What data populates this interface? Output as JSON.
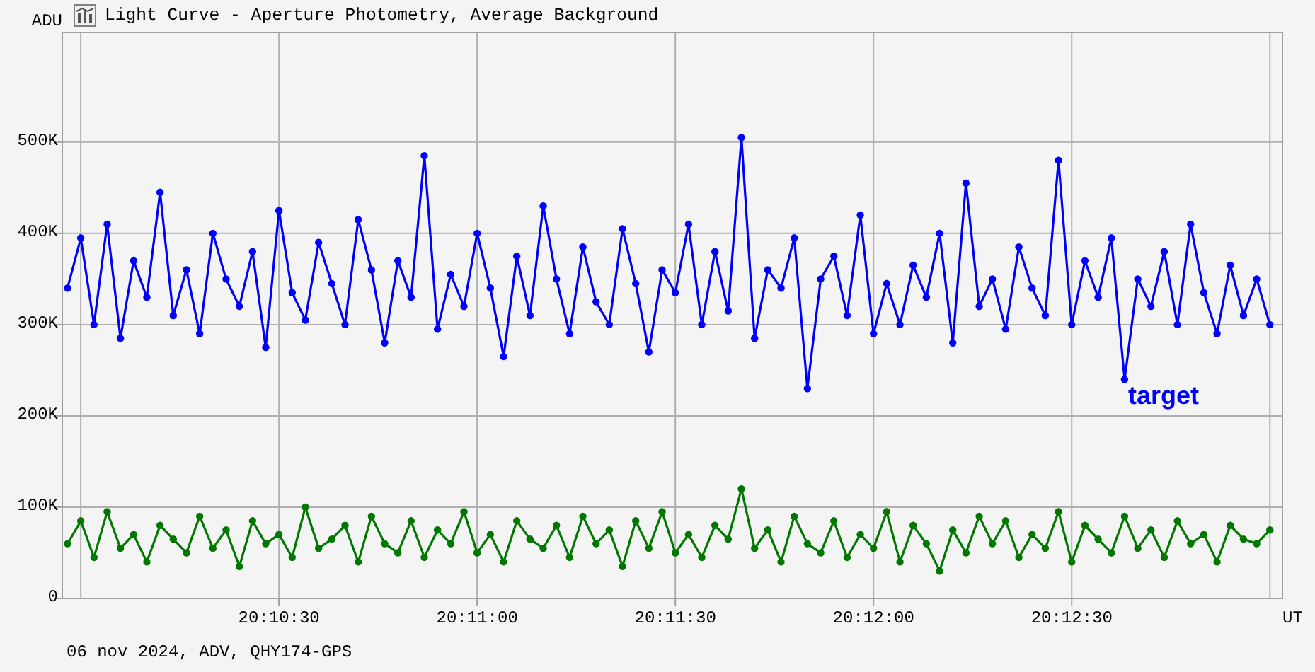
{
  "window": {
    "title": "Light Curve - Aperture Photometry, Average Background"
  },
  "chart": {
    "chart_data": {
      "type": "line",
      "grid": true,
      "ylabel": "ADU",
      "xlabel": "UT",
      "xlim": [
        72597.2,
        72781.9
      ],
      "ylim": [
        0,
        620000
      ],
      "xticks": [
        {
          "value": 72630,
          "label": "20:10:30"
        },
        {
          "value": 72660,
          "label": "20:11:00"
        },
        {
          "value": 72690,
          "label": "20:11:30"
        },
        {
          "value": 72720,
          "label": "20:12:00"
        },
        {
          "value": 72750,
          "label": "20:12:30"
        }
      ],
      "yticks": [
        {
          "value": 0,
          "label": "0"
        },
        {
          "value": 100000,
          "label": "100K"
        },
        {
          "value": 200000,
          "label": "200K"
        },
        {
          "value": 300000,
          "label": "300K"
        },
        {
          "value": 400000,
          "label": "400K"
        },
        {
          "value": 500000,
          "label": "500K"
        }
      ],
      "x": [
        72598,
        72600,
        72602,
        72604,
        72606,
        72608,
        72610,
        72612,
        72614,
        72616,
        72618,
        72620,
        72622,
        72624,
        72626,
        72628,
        72630,
        72632,
        72634,
        72636,
        72638,
        72640,
        72642,
        72644,
        72646,
        72648,
        72650,
        72652,
        72654,
        72656,
        72658,
        72660,
        72662,
        72664,
        72666,
        72668,
        72670,
        72672,
        72674,
        72676,
        72678,
        72680,
        72682,
        72684,
        72686,
        72688,
        72690,
        72692,
        72694,
        72696,
        72698,
        72700,
        72702,
        72704,
        72706,
        72708,
        72710,
        72712,
        72714,
        72716,
        72718,
        72720,
        72722,
        72724,
        72726,
        72728,
        72730,
        72732,
        72734,
        72736,
        72738,
        72740,
        72742,
        72744,
        72746,
        72748,
        72750,
        72752,
        72754,
        72756,
        72758,
        72760,
        72762,
        72764,
        72766,
        72768,
        72770,
        72772,
        72774,
        72776,
        72778,
        72780
      ],
      "series": [
        {
          "name": "target",
          "color": "#0000ff",
          "marker": "circle",
          "values": [
            340000,
            395000,
            300000,
            410000,
            285000,
            370000,
            330000,
            445000,
            310000,
            360000,
            290000,
            400000,
            350000,
            320000,
            380000,
            275000,
            425000,
            335000,
            305000,
            390000,
            345000,
            300000,
            415000,
            360000,
            280000,
            370000,
            330000,
            485000,
            295000,
            355000,
            320000,
            400000,
            340000,
            265000,
            375000,
            310000,
            430000,
            350000,
            290000,
            385000,
            325000,
            300000,
            405000,
            345000,
            270000,
            360000,
            335000,
            410000,
            300000,
            380000,
            315000,
            505000,
            285000,
            360000,
            340000,
            395000,
            230000,
            350000,
            375000,
            310000,
            420000,
            290000,
            345000,
            300000,
            365000,
            330000,
            400000,
            280000,
            455000,
            320000,
            350000,
            295000,
            385000,
            340000,
            310000,
            480000,
            300000,
            370000,
            330000,
            395000,
            240000,
            350000,
            320000,
            380000,
            300000,
            410000,
            335000,
            290000,
            365000,
            310000,
            350000,
            300000
          ]
        },
        {
          "color": "#007800",
          "marker": "circle",
          "values": [
            60000,
            85000,
            45000,
            95000,
            55000,
            70000,
            40000,
            80000,
            65000,
            50000,
            90000,
            55000,
            75000,
            35000,
            85000,
            60000,
            70000,
            45000,
            100000,
            55000,
            65000,
            80000,
            40000,
            90000,
            60000,
            50000,
            85000,
            45000,
            75000,
            60000,
            95000,
            50000,
            70000,
            40000,
            85000,
            65000,
            55000,
            80000,
            45000,
            90000,
            60000,
            75000,
            35000,
            85000,
            55000,
            95000,
            50000,
            70000,
            45000,
            80000,
            65000,
            120000,
            55000,
            75000,
            40000,
            90000,
            60000,
            50000,
            85000,
            45000,
            70000,
            55000,
            95000,
            40000,
            80000,
            60000,
            30000,
            75000,
            50000,
            90000,
            60000,
            85000,
            45000,
            70000,
            55000,
            95000,
            40000,
            80000,
            65000,
            50000,
            90000,
            55000,
            75000,
            45000,
            85000,
            60000,
            70000,
            40000,
            80000,
            65000,
            60000,
            75000
          ]
        }
      ]
    }
  },
  "footer": {
    "text": "06 nov 2024, ADV, QHY174-GPS"
  }
}
